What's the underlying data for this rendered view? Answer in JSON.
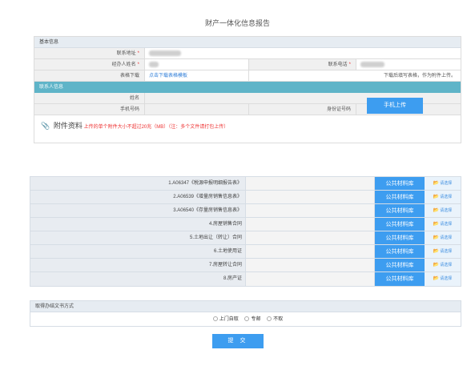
{
  "page": {
    "title": "财产一体化信息报告"
  },
  "basic": {
    "header": "基本信息",
    "address_label": "联系地址",
    "applicant_label": "经办人姓名",
    "phone_label": "联系电话",
    "form_download_label": "表格下载",
    "form_download_link": "点击下载表格模板",
    "form_note": "下载后填写表格，作为附件上传。",
    "required_mark": "*"
  },
  "contact": {
    "header": "联系人信息",
    "name_label": "姓名",
    "mobile_label": "手机号码",
    "id_label": "身份证号码"
  },
  "attachment": {
    "title": "附件资料",
    "hint": "上传的单个附件大小不超过20兆（MB）（注：多个文件请打包上传）",
    "mobile_upload_label": "手机上传"
  },
  "materials": [
    {
      "name": "1.A06347《税源申报明细报告表》",
      "library": "公共材料库",
      "pick": "请选择"
    },
    {
      "name": "2.A06539《增量房销售信息表》",
      "library": "公共材料库",
      "pick": "请选择"
    },
    {
      "name": "3.A06540《存量房销售信息表》",
      "library": "公共材料库",
      "pick": "请选择"
    },
    {
      "name": "4.房屋销售合同",
      "library": "公共材料库",
      "pick": "请选择"
    },
    {
      "name": "5.土地出让（转让）合同",
      "library": "公共材料库",
      "pick": "请选择"
    },
    {
      "name": "6.土地使用证",
      "library": "公共材料库",
      "pick": "请选择"
    },
    {
      "name": "7.房屋转让合同",
      "library": "公共材料库",
      "pick": "请选择"
    },
    {
      "name": "8.房产证",
      "library": "公共材料库",
      "pick": "请选择"
    }
  ],
  "delivery": {
    "header": "取得办结文书方式",
    "options": [
      "上门自取",
      "专邮",
      "不取"
    ]
  },
  "submit_label": "提 交"
}
